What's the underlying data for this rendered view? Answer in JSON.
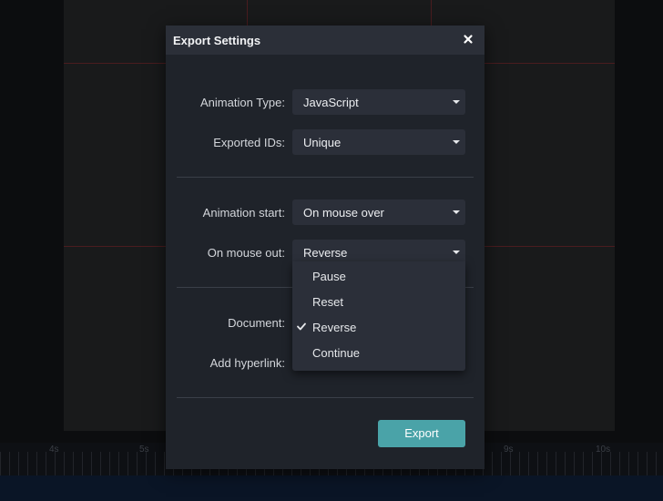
{
  "background": {
    "timeline_labels": [
      "4s",
      "5s",
      "9s",
      "10s"
    ]
  },
  "dialog": {
    "title": "Export Settings",
    "close_icon": "close-icon",
    "fields": {
      "animation_type": {
        "label": "Animation Type:",
        "value": "JavaScript"
      },
      "exported_ids": {
        "label": "Exported IDs:",
        "value": "Unique"
      },
      "animation_start": {
        "label": "Animation start:",
        "value": "On mouse over"
      },
      "on_mouse_out": {
        "label": "On mouse out:",
        "value": "Reverse"
      },
      "document": {
        "label": "Document:"
      },
      "add_hyperlink": {
        "label": "Add hyperlink:"
      }
    },
    "dropdown": {
      "items": [
        {
          "label": "Pause",
          "selected": false
        },
        {
          "label": "Reset",
          "selected": false
        },
        {
          "label": "Reverse",
          "selected": true
        },
        {
          "label": "Continue",
          "selected": false
        }
      ]
    },
    "export_label": "Export"
  },
  "colors": {
    "accent": "#4aa3a8",
    "dialog_bg": "#1f232a",
    "header_bg": "#2b2f38",
    "control_bg": "#2b2f39"
  }
}
